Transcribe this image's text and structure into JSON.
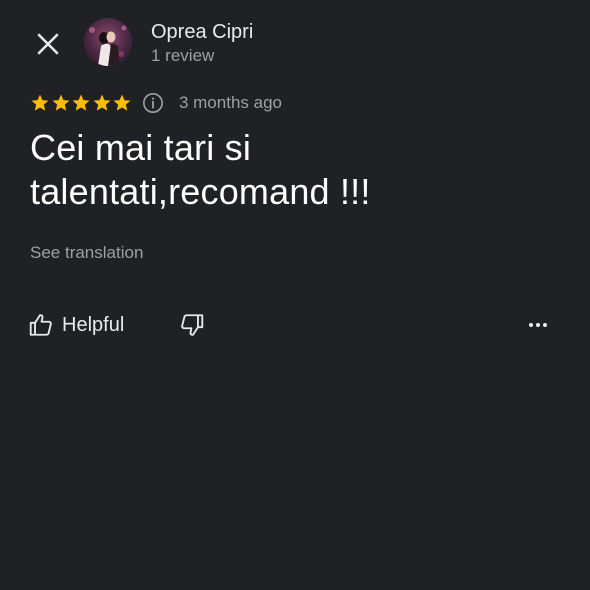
{
  "header": {
    "close_icon": "close-icon",
    "author_name": "Oprea Cipri",
    "author_meta": "1 review",
    "avatar_icon": "user-avatar"
  },
  "review": {
    "rating": 5,
    "rating_max": 5,
    "star_color": "#fbbc04",
    "info_icon": "info-icon",
    "time": "3 months ago",
    "text": "Cei mai tari si talentati,recomand !!!",
    "see_translation": "See translation"
  },
  "actions": {
    "helpful_label": "Helpful",
    "helpful_icon": "thumbs-up-icon",
    "dislike_icon": "thumbs-down-icon",
    "more_icon": "more-horizontal-icon"
  },
  "colors": {
    "background": "#202124",
    "primary_text": "#e8eaed",
    "secondary_text": "#9aa0a6",
    "star": "#fbbc04"
  }
}
